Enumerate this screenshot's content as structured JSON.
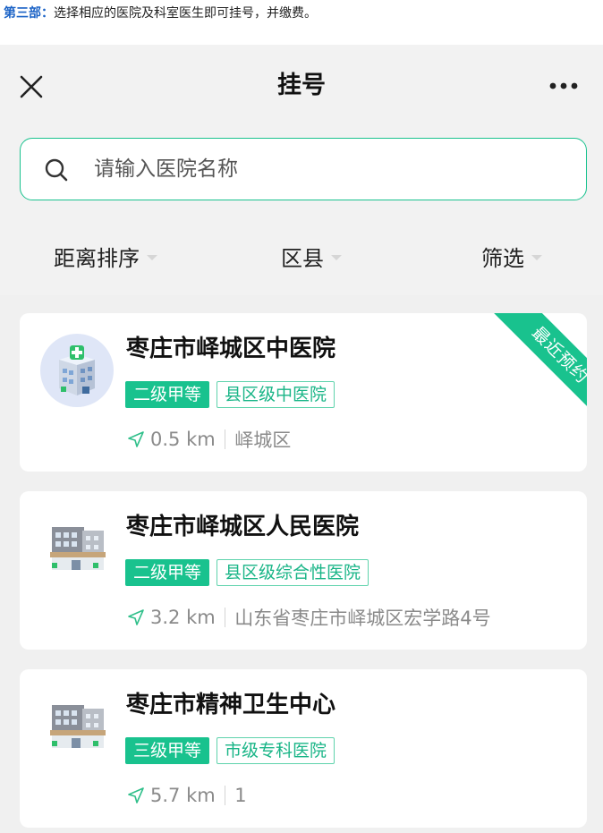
{
  "caption": {
    "label": "第三部：",
    "text": "选择相应的医院及科室医生即可挂号，并缴费。"
  },
  "navbar": {
    "title": "挂号",
    "close_icon": "close-icon",
    "more_icon": "more-dots-icon"
  },
  "search": {
    "placeholder": "请输入医院名称",
    "value": "",
    "icon": "search-icon"
  },
  "filters": [
    {
      "label": "距离排序"
    },
    {
      "label": "区县"
    },
    {
      "label": "筛选"
    }
  ],
  "hospitals": [
    {
      "name": "枣庄市峄城区中医院",
      "level": "二级甲等",
      "type": "县区级中医院",
      "distance": "0.5 km",
      "location": "峄城区",
      "badge": "最近预约",
      "icon": "hospital-round-icon"
    },
    {
      "name": "枣庄市峄城区人民医院",
      "level": "二级甲等",
      "type": "县区级综合性医院",
      "distance": "3.2 km",
      "location": "山东省枣庄市峄城区宏学路4号",
      "icon": "clinic-building-icon"
    },
    {
      "name": "枣庄市精神卫生中心",
      "level": "三级甲等",
      "type": "市级专科医院",
      "distance": "5.7 km",
      "location": "1",
      "icon": "clinic-building-icon"
    }
  ],
  "colors": {
    "accent": "#19c28e",
    "caption_label": "#1a62c6",
    "muted_text": "#8a8a8a",
    "page_bg": "#f2f2f2"
  }
}
